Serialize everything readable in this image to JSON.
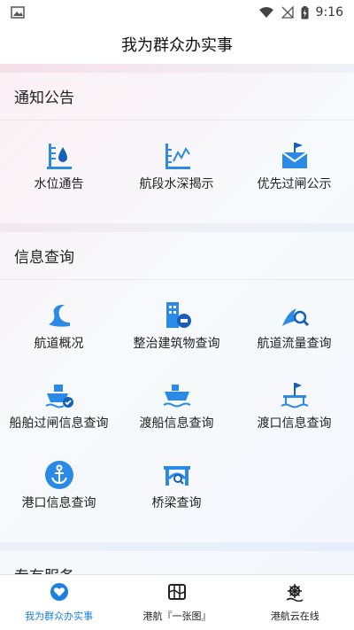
{
  "status_bar": {
    "time": "9:16"
  },
  "header": {
    "title": "我为群众办实事"
  },
  "sections": [
    {
      "title": "通知公告",
      "items": [
        {
          "label": "水位通告",
          "icon": "water-level-icon"
        },
        {
          "label": "航段水深揭示",
          "icon": "depth-chart-icon"
        },
        {
          "label": "优先过闸公示",
          "icon": "lock-flag-icon"
        }
      ]
    },
    {
      "title": "信息查询",
      "items": [
        {
          "label": "航道概况",
          "icon": "channel-icon"
        },
        {
          "label": "整治建筑物查询",
          "icon": "building-icon"
        },
        {
          "label": "航道流量查询",
          "icon": "flow-icon"
        },
        {
          "label": "船舶过闸信息查询",
          "icon": "ship-icon"
        },
        {
          "label": "渡船信息查询",
          "icon": "ferry-icon"
        },
        {
          "label": "渡口信息查询",
          "icon": "dock-icon"
        },
        {
          "label": "港口信息查询",
          "icon": "anchor-icon"
        },
        {
          "label": "桥梁查询",
          "icon": "bridge-icon"
        }
      ]
    },
    {
      "title": "专有服务"
    }
  ],
  "tabs": [
    {
      "label": "我为群众办实事",
      "icon": "heart-hands-icon",
      "active": true
    },
    {
      "label": "港航『一张图』",
      "icon": "map-icon",
      "active": false
    },
    {
      "label": "港航云在线",
      "icon": "helm-icon",
      "active": false
    }
  ],
  "colors": {
    "accent": "#1d7fe0",
    "icon_blue": "#2b8ae6",
    "icon_dark": "#1760b8"
  }
}
